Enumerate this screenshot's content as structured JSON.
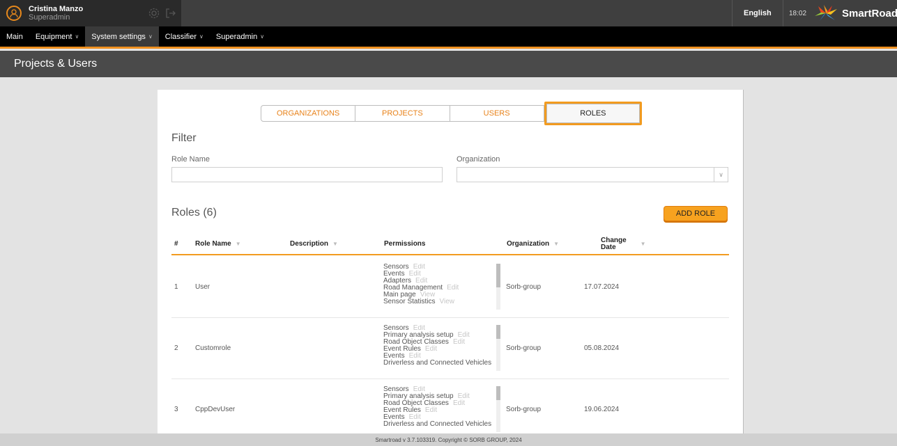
{
  "user": {
    "name": "Cristina Manzo",
    "role": "Superadmin"
  },
  "header": {
    "language": "English",
    "time": "18:02",
    "brand": "SmartRoad"
  },
  "menu": [
    {
      "label": "Main",
      "dropdown": false
    },
    {
      "label": "Equipment",
      "dropdown": true
    },
    {
      "label": "System settings",
      "dropdown": true,
      "active": true
    },
    {
      "label": "Classifier",
      "dropdown": true
    },
    {
      "label": "Superadmin",
      "dropdown": true
    }
  ],
  "page": {
    "title": "Projects & Users"
  },
  "tabs": [
    "ORGANIZATIONS",
    "PROJECTS",
    "USERS",
    "ROLES"
  ],
  "filter": {
    "title": "Filter",
    "role_name_label": "Role Name",
    "role_name_value": "",
    "organization_label": "Organization",
    "organization_value": ""
  },
  "roles": {
    "title": "Roles (6)",
    "add_button": "ADD ROLE",
    "columns": {
      "num": "#",
      "role_name": "Role Name",
      "description": "Description",
      "permissions": "Permissions",
      "organization": "Organization",
      "change_date_1": "Change",
      "change_date_2": "Date"
    },
    "rows": [
      {
        "num": "1",
        "name": "User",
        "description": "",
        "organization": "Sorb-group",
        "date": "17.07.2024",
        "permissions": [
          {
            "name": "Sensors",
            "access": "Edit"
          },
          {
            "name": "Events",
            "access": "Edit"
          },
          {
            "name": "Adapters",
            "access": "Edit"
          },
          {
            "name": "Road Management",
            "access": "Edit"
          },
          {
            "name": "Main page",
            "access": "View"
          },
          {
            "name": "Sensor Statistics",
            "access": "View"
          }
        ]
      },
      {
        "num": "2",
        "name": "Customrole",
        "description": "",
        "organization": "Sorb-group",
        "date": "05.08.2024",
        "permissions": [
          {
            "name": "Sensors",
            "access": "Edit"
          },
          {
            "name": "Primary analysis setup",
            "access": "Edit"
          },
          {
            "name": "Road Object Classes",
            "access": "Edit"
          },
          {
            "name": "Event Rules",
            "access": "Edit"
          },
          {
            "name": "Events",
            "access": "Edit"
          },
          {
            "name": "Driverless and Connected Vehicles",
            "access": ""
          }
        ]
      },
      {
        "num": "3",
        "name": "CppDevUser",
        "description": "",
        "organization": "Sorb-group",
        "date": "19.06.2024",
        "permissions": [
          {
            "name": "Sensors",
            "access": "Edit"
          },
          {
            "name": "Primary analysis setup",
            "access": "Edit"
          },
          {
            "name": "Road Object Classes",
            "access": "Edit"
          },
          {
            "name": "Event Rules",
            "access": "Edit"
          },
          {
            "name": "Events",
            "access": "Edit"
          },
          {
            "name": "Driverless and Connected Vehicles",
            "access": ""
          }
        ]
      }
    ]
  },
  "footer": {
    "text": "Smartroad v 3.7.103319. Copyright © SORB GROUP, 2024"
  },
  "colors": {
    "accent": "#f29b1f",
    "topbar": "#3f3f3f",
    "menubar": "#000000",
    "titlebar": "#4a4a4a"
  }
}
